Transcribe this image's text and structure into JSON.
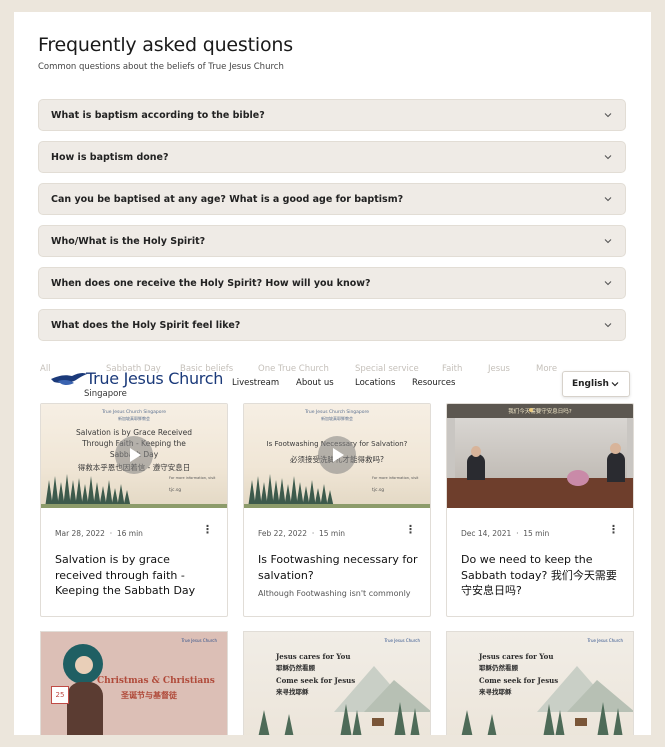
{
  "faq": {
    "title": "Frequently asked questions",
    "subtitle": "Common questions about the beliefs of True Jesus Church",
    "items": [
      "What is baptism according to the bible?",
      "How is baptism done?",
      "Can you be baptised at any age? What is a good age for baptism?",
      "Who/What is the Holy Spirit?",
      "When does one receive the Holy Spirit? How will you know?",
      "What does the Holy Spirit feel like?"
    ]
  },
  "tabs": [
    "All",
    "Sabbath Day",
    "Basic beliefs",
    "One True Church",
    "Special service",
    "Faith",
    "Jesus",
    "More"
  ],
  "nav": {
    "logo": "True Jesus Church",
    "logo_sub": "Singapore",
    "links": [
      "Livestream",
      "About us",
      "Locations",
      "Resources"
    ],
    "language": "English"
  },
  "cards": [
    {
      "date": "Mar 28, 2022",
      "duration": "16 min",
      "title": "Salvation is by grace received through faith - Keeping the Sabbath Day",
      "desc": "",
      "thumb_org": "True Jesus Church Singapore",
      "thumb_org_cn": "新加坡真耶稣教会",
      "thumb_line1": "Salvation is by Grace Received",
      "thumb_line2": "Through Faith - Keeping the",
      "thumb_line3": "Sabbath Day",
      "thumb_cn": "得救本乎恩也因着信 - 遵守安息日",
      "thumb_info": "For more information, visit",
      "thumb_site": "tjc.sg"
    },
    {
      "date": "Feb 22, 2022",
      "duration": "15 min",
      "title": "Is Footwashing necessary for salvation?",
      "desc": "Although Footwashing isn't commonly",
      "thumb_org": "True Jesus Church Singapore",
      "thumb_org_cn": "新加坡真耶稣教会",
      "thumb_line1": "Is Footwashing Necessary for Salvation?",
      "thumb_cn": "必须接受洗脚礼才能得救吗?",
      "thumb_info": "For more information, visit",
      "thumb_site": "tjc.sg"
    },
    {
      "date": "Dec 14, 2021",
      "duration": "15 min",
      "title": "Do we need to keep the Sabbath today? 我们今天需要守安息日吗?",
      "desc": "",
      "thumb_banner": "我们今天需要守安息日吗?"
    }
  ],
  "bottom_cards": [
    {
      "brand": "True Jesus Church",
      "title_en": "Christmas & Christians",
      "title_cn": "圣诞节与基督徒",
      "calendar_day": "25"
    },
    {
      "brand": "True Jesus Church",
      "line1": "Jesus cares for You",
      "line1_cn": "耶稣仍然看顾",
      "line2": "Come seek for Jesus",
      "line2_cn": "来寻找耶稣"
    },
    {
      "brand": "True Jesus Church",
      "line1": "Jesus cares for You",
      "line1_cn": "耶稣仍然看顾",
      "line2": "Come seek for Jesus",
      "line2_cn": "来寻找耶稣"
    }
  ],
  "colors": {
    "background": "#ece6dc",
    "faq_item": "#efebe6",
    "brand_blue": "#1b3a7a",
    "tab_muted": "#c5c0ba"
  }
}
